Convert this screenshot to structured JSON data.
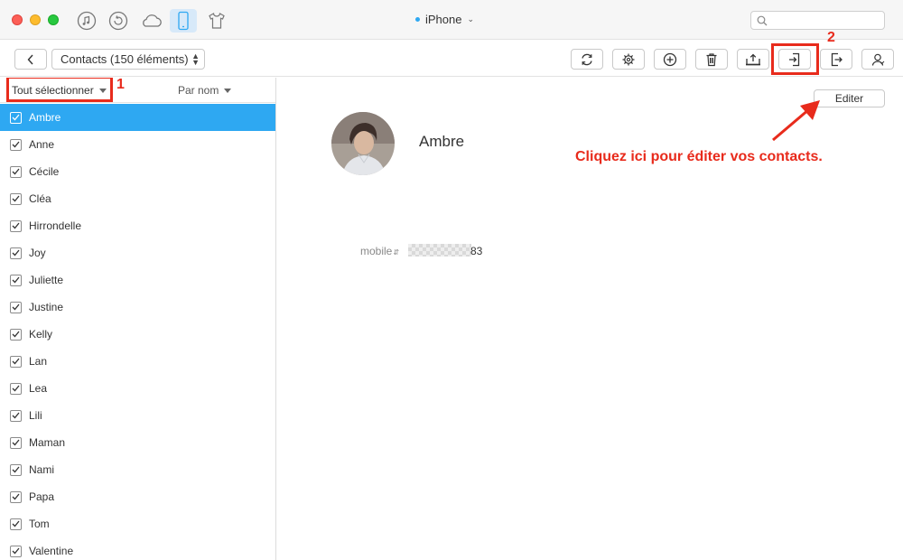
{
  "titlebar": {
    "device_name": "iPhone",
    "tab_icons": [
      "music-icon",
      "restore-icon",
      "cloud-icon",
      "phone-icon",
      "shirt-icon"
    ]
  },
  "toolbar": {
    "contacts_select": "Contacts (150 éléments)",
    "tools": [
      "refresh-icon",
      "settings-icon",
      "add-icon",
      "delete-icon",
      "export-to-computer-icon",
      "import-icon",
      "export-icon",
      "contact-icon"
    ]
  },
  "annotations": {
    "step1": "1",
    "step2": "2",
    "hint": "Cliquez ici pour éditer vos contacts.",
    "color": "#e82b1c"
  },
  "list": {
    "select_all": "Tout sélectionner",
    "sort": "Par nom",
    "accent": "#2ea8f2",
    "contacts": [
      "Ambre",
      "Anne",
      "Cécile",
      "Cléa",
      "Hirrondelle",
      "Joy",
      "Juliette",
      "Justine",
      "Kelly",
      "Lan",
      "Lea",
      "Lili",
      "Maman",
      "Nami",
      "Papa",
      "Tom",
      "Valentine"
    ]
  },
  "detail": {
    "name": "Ambre",
    "edit_label": "Editer",
    "phone_label": "mobile",
    "phone_suffix": "83"
  }
}
